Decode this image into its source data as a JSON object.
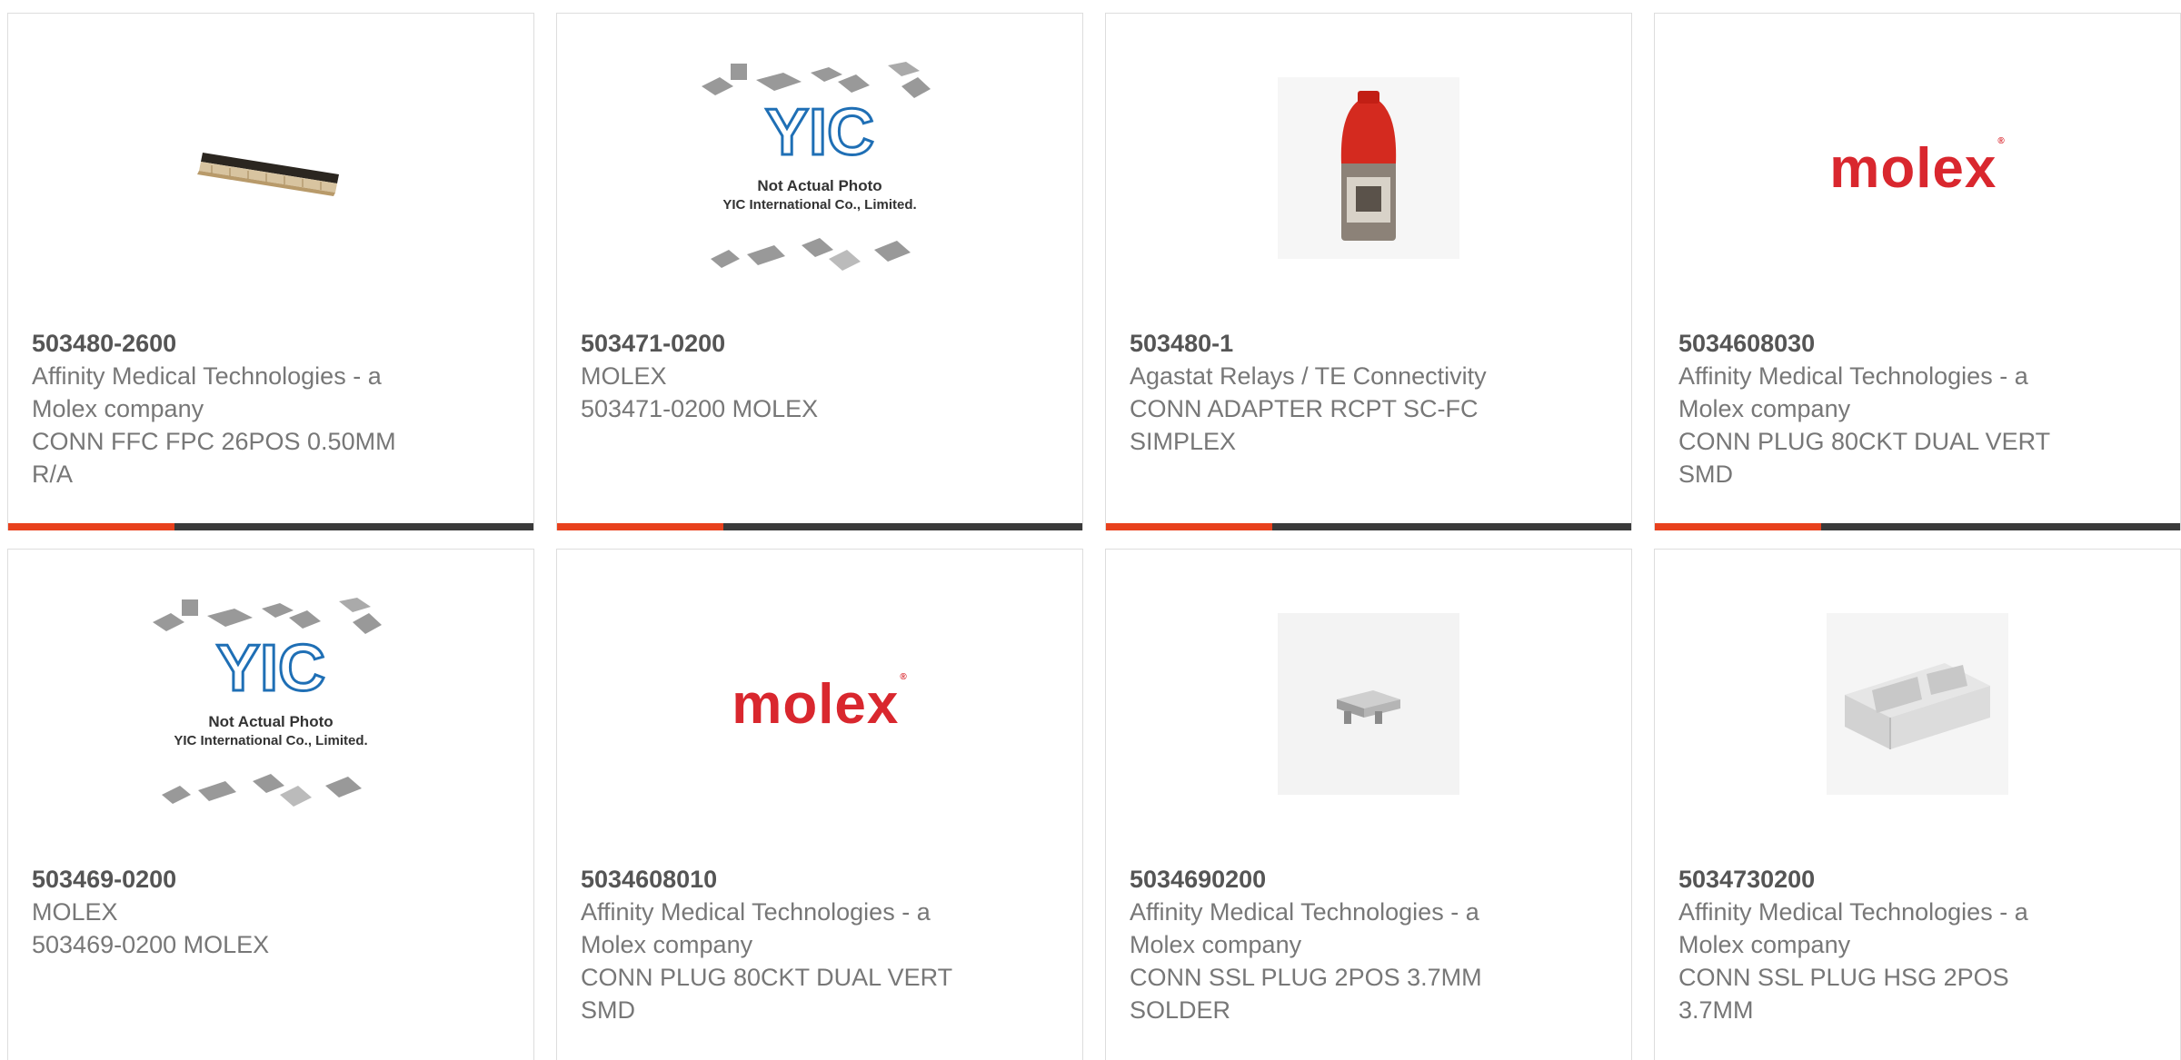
{
  "products": [
    {
      "part_number": "503480-2600",
      "manufacturer": "Affinity Medical Technologies - a Molex company",
      "description": "CONN FFC FPC 26POS 0.50MM R/A",
      "image": "ffc-connector-photo"
    },
    {
      "part_number": "503471-0200",
      "manufacturer": "MOLEX",
      "description": "503471-0200 MOLEX",
      "image": "yic-placeholder",
      "placeholder_text_1": "Not Actual Photo",
      "placeholder_text_2": "YIC International Co., Limited."
    },
    {
      "part_number": "503480-1",
      "manufacturer": "Agastat Relays / TE Connectivity",
      "description": "CONN ADAPTER RCPT SC-FC SIMPLEX",
      "image": "fiber-adapter-photo"
    },
    {
      "part_number": "5034608030",
      "manufacturer": "Affinity Medical Technologies - a Molex company",
      "description": "CONN PLUG 80CKT DUAL VERT SMD",
      "image": "molex-logo",
      "logo_text": "molex"
    },
    {
      "part_number": "503469-0200",
      "manufacturer": "MOLEX",
      "description": "503469-0200 MOLEX",
      "image": "yic-placeholder",
      "placeholder_text_1": "Not Actual Photo",
      "placeholder_text_2": "YIC International Co., Limited."
    },
    {
      "part_number": "5034608010",
      "manufacturer": "Affinity Medical Technologies - a Molex company",
      "description": "CONN PLUG 80CKT DUAL VERT SMD",
      "image": "molex-logo",
      "logo_text": "molex"
    },
    {
      "part_number": "5034690200",
      "manufacturer": "Affinity Medical Technologies - a Molex company",
      "description": "CONN SSL PLUG 2POS 3.7MM SOLDER",
      "image": "ssl-plug-photo"
    },
    {
      "part_number": "5034730200",
      "manufacturer": "Affinity Medical Technologies - a Molex company",
      "description": "CONN SSL PLUG HSG 2POS 3.7MM",
      "image": "plug-housing-photo"
    }
  ],
  "colors": {
    "accent": "#e8411d",
    "bar": "#3a3a3a",
    "molex_red": "#d9272e",
    "yic_blue": "#1f6fb5"
  }
}
